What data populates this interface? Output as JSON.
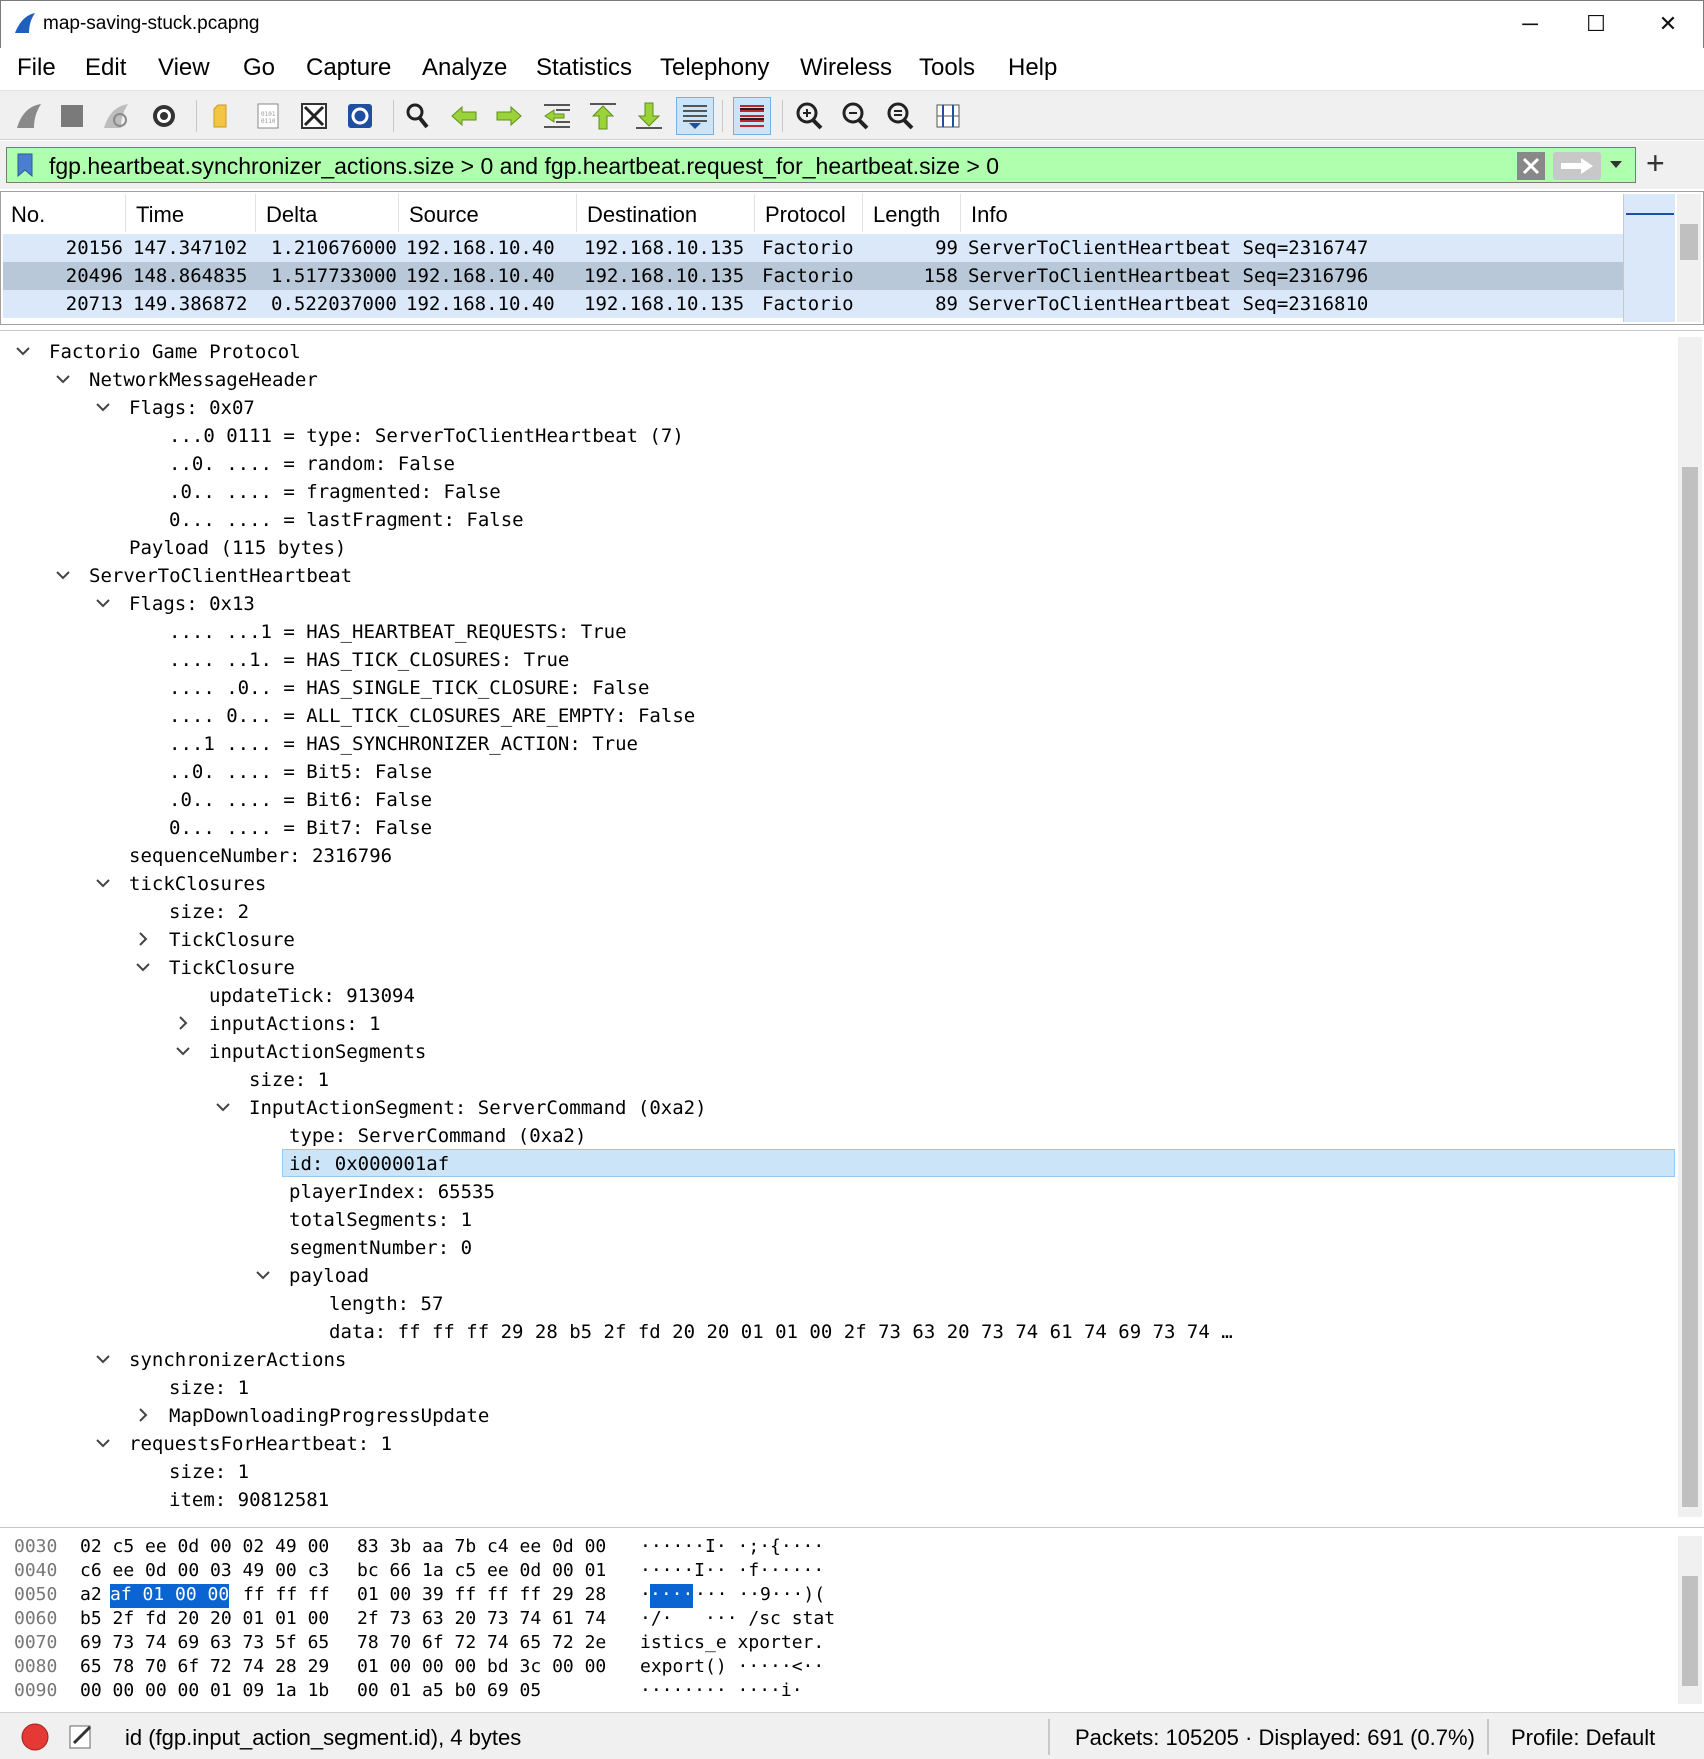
{
  "window": {
    "title": "map-saving-stuck.pcapng"
  },
  "menu": [
    "File",
    "Edit",
    "View",
    "Go",
    "Capture",
    "Analyze",
    "Statistics",
    "Telephony",
    "Wireless",
    "Tools",
    "Help"
  ],
  "toolbar": {
    "icons": [
      "shark-fin-start-icon",
      "stop-capture-icon",
      "restart-capture-icon",
      "capture-options-icon",
      "open-file-icon",
      "save-file-icon",
      "close-file-icon",
      "reload-file-icon",
      "find-packet-icon",
      "go-back-icon",
      "go-forward-icon",
      "go-to-packet-icon",
      "first-packet-icon",
      "last-packet-icon",
      "auto-scroll-icon",
      "colorize-icon",
      "zoom-in-icon",
      "zoom-out-icon",
      "zoom-normal-icon",
      "resize-columns-icon"
    ]
  },
  "filter": {
    "expression": "fgp.heartbeat.synchronizer_actions.size > 0 and fgp.heartbeat.request_for_heartbeat.size > 0",
    "color": "#afffaf"
  },
  "packet_list": {
    "columns": [
      "No.",
      "Time",
      "Delta",
      "Source",
      "Destination",
      "Protocol",
      "Length",
      "Info"
    ],
    "rows": [
      {
        "no": "20156",
        "time": "147.347102",
        "delta": "1.210676000",
        "src": "192.168.10.40",
        "dst": "192.168.10.135",
        "proto": "Factorio",
        "len": "99",
        "info": "ServerToClientHeartbeat Seq=2316747"
      },
      {
        "no": "20496",
        "time": "148.864835",
        "delta": "1.517733000",
        "src": "192.168.10.40",
        "dst": "192.168.10.135",
        "proto": "Factorio",
        "len": "158",
        "info": "ServerToClientHeartbeat Seq=2316796"
      },
      {
        "no": "20713",
        "time": "149.386872",
        "delta": "0.522037000",
        "src": "192.168.10.40",
        "dst": "192.168.10.135",
        "proto": "Factorio",
        "len": "89",
        "info": "ServerToClientHeartbeat Seq=2316810"
      }
    ]
  },
  "tree": [
    {
      "t": "Factorio Game Protocol",
      "l": 0,
      "c": "open"
    },
    {
      "t": "NetworkMessageHeader",
      "l": 1,
      "c": "open"
    },
    {
      "t": "Flags: 0x07",
      "l": 2,
      "c": "open"
    },
    {
      "t": "...0 0111 = type: ServerToClientHeartbeat (7)",
      "l": 3,
      "c": ""
    },
    {
      "t": "..0. .... = random: False",
      "l": 3,
      "c": ""
    },
    {
      "t": ".0.. .... = fragmented: False",
      "l": 3,
      "c": ""
    },
    {
      "t": "0... .... = lastFragment: False",
      "l": 3,
      "c": ""
    },
    {
      "t": "Payload (115 bytes)",
      "l": 2,
      "c": ""
    },
    {
      "t": "ServerToClientHeartbeat",
      "l": 1,
      "c": "open"
    },
    {
      "t": "Flags: 0x13",
      "l": 2,
      "c": "open"
    },
    {
      "t": ".... ...1 = HAS_HEARTBEAT_REQUESTS: True",
      "l": 3,
      "c": ""
    },
    {
      "t": ".... ..1. = HAS_TICK_CLOSURES: True",
      "l": 3,
      "c": ""
    },
    {
      "t": ".... .0.. = HAS_SINGLE_TICK_CLOSURE: False",
      "l": 3,
      "c": ""
    },
    {
      "t": ".... 0... = ALL_TICK_CLOSURES_ARE_EMPTY: False",
      "l": 3,
      "c": ""
    },
    {
      "t": "...1 .... = HAS_SYNCHRONIZER_ACTION: True",
      "l": 3,
      "c": ""
    },
    {
      "t": "..0. .... = Bit5: False",
      "l": 3,
      "c": ""
    },
    {
      "t": ".0.. .... = Bit6: False",
      "l": 3,
      "c": ""
    },
    {
      "t": "0... .... = Bit7: False",
      "l": 3,
      "c": ""
    },
    {
      "t": "sequenceNumber: 2316796",
      "l": 2,
      "c": ""
    },
    {
      "t": "tickClosures",
      "l": 2,
      "c": "open"
    },
    {
      "t": "size: 2",
      "l": 3,
      "c": ""
    },
    {
      "t": "TickClosure",
      "l": 3,
      "c": "closed"
    },
    {
      "t": "TickClosure",
      "l": 3,
      "c": "open"
    },
    {
      "t": "updateTick: 913094",
      "l": 4,
      "c": ""
    },
    {
      "t": "inputActions: 1",
      "l": 4,
      "c": "closed"
    },
    {
      "t": "inputActionSegments",
      "l": 4,
      "c": "open"
    },
    {
      "t": "size: 1",
      "l": 5,
      "c": ""
    },
    {
      "t": "InputActionSegment: ServerCommand (0xa2)",
      "l": 5,
      "c": "open"
    },
    {
      "t": "type: ServerCommand (0xa2)",
      "l": 6,
      "c": ""
    },
    {
      "t": "id: 0x000001af",
      "l": 6,
      "c": "",
      "sel": true
    },
    {
      "t": "playerIndex: 65535",
      "l": 6,
      "c": ""
    },
    {
      "t": "totalSegments: 1",
      "l": 6,
      "c": ""
    },
    {
      "t": "segmentNumber: 0",
      "l": 6,
      "c": ""
    },
    {
      "t": "payload",
      "l": 6,
      "c": "open"
    },
    {
      "t": "length: 57",
      "l": 7,
      "c": ""
    },
    {
      "t": "data: ff ff ff 29 28 b5 2f fd 20 20 01 01 00 2f 73 63 20 73 74 61 74 69 73 74 …",
      "l": 7,
      "c": ""
    },
    {
      "t": "synchronizerActions",
      "l": 2,
      "c": "open"
    },
    {
      "t": "size: 1",
      "l": 3,
      "c": ""
    },
    {
      "t": "MapDownloadingProgressUpdate",
      "l": 3,
      "c": "closed"
    },
    {
      "t": "requestsForHeartbeat: 1",
      "l": 2,
      "c": "open"
    },
    {
      "t": "size: 1",
      "l": 3,
      "c": ""
    },
    {
      "t": "item: 90812581",
      "l": 3,
      "c": ""
    }
  ],
  "hex": [
    {
      "off": "0030",
      "a": "02 c5 ee 0d 00 02 49 00",
      "b": "83 3b aa 7b c4 ee 0d 00",
      "ascii": "······I· ·;·{····"
    },
    {
      "off": "0040",
      "a": "c6 ee 0d 00 03 49 00 c3",
      "b": "bc 66 1a c5 ee 0d 00 01",
      "ascii": "·····I·· ·f······"
    },
    {
      "off": "0050",
      "a": "a2",
      "ahl": "af 01 00 00",
      "a2": "ff ff ff",
      "b": "01 00 39 ff ff ff 29 28",
      "asc1": "·",
      "aschl": "····",
      "asc2": "··· ··9···)("
    },
    {
      "off": "0060",
      "a": "b5 2f fd 20 20 01 01 00",
      "b": "2f 73 63 20 73 74 61 74",
      "ascii": "·/·   ··· /sc stat"
    },
    {
      "off": "0070",
      "a": "69 73 74 69 63 73 5f 65",
      "b": "78 70 6f 72 74 65 72 2e",
      "ascii": "istics_e xporter."
    },
    {
      "off": "0080",
      "a": "65 78 70 6f 72 74 28 29",
      "b": "01 00 00 00 bd 3c 00 00",
      "ascii": "export() ·····<··"
    },
    {
      "off": "0090",
      "a": "00 00 00 00 01 09 1a 1b",
      "b": "00 01 a5 b0 69 05",
      "ascii": "········ ····i·"
    }
  ],
  "status": {
    "field": "id (fgp.input_action_segment.id), 4 bytes",
    "packets": "Packets: 105205 · Displayed: 691 (0.7%)",
    "profile": "Profile: Default"
  },
  "colors": {
    "selected_row": "#b8c8d8",
    "row_bg": "#dae8fa",
    "tree_selected": "#cce4f7",
    "hex_highlight": "#0a64d2"
  }
}
